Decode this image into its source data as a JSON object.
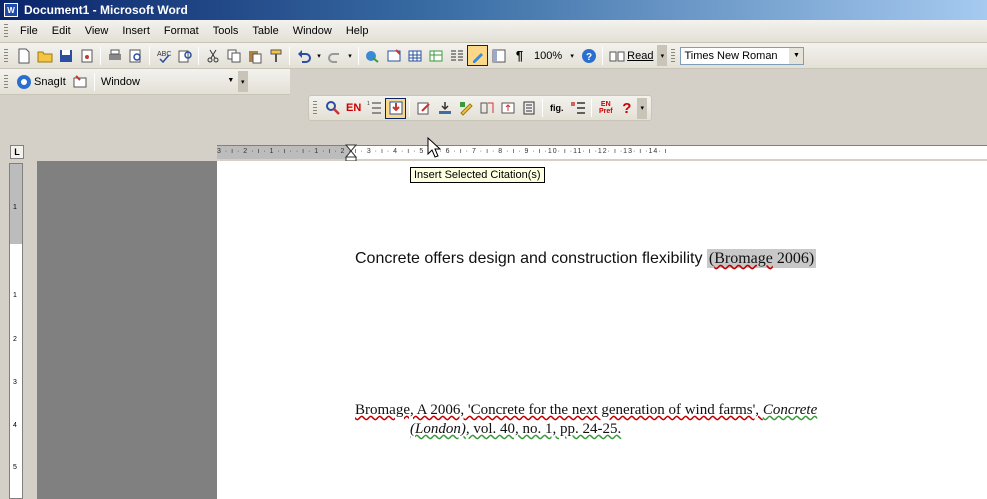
{
  "window": {
    "title": "Document1 - Microsoft Word",
    "app_icon": "W"
  },
  "menu": [
    {
      "label": "File"
    },
    {
      "label": "Edit"
    },
    {
      "label": "View"
    },
    {
      "label": "Insert"
    },
    {
      "label": "Format"
    },
    {
      "label": "Tools"
    },
    {
      "label": "Table"
    },
    {
      "label": "Window"
    },
    {
      "label": "Help"
    }
  ],
  "standard_toolbar": {
    "zoom": "100%",
    "read_label": "Read",
    "font": "Times New Roman"
  },
  "snagit_toolbar": {
    "snagit_label": "SnagIt",
    "capture_mode": "Window"
  },
  "endnote_toolbar": {
    "en_label": "EN",
    "fig_label": "fig.",
    "pref_label": "EN Pref",
    "help_label": "?"
  },
  "tooltip": "Insert Selected Citation(s)",
  "ruler": {
    "corner": "L",
    "ticks": "3 · ı · 2 · ı · 1 · ı ·   · ı · 1 · ı · 2 · ı · 3 · ı · 4 · ı · 5 · ı · 6 · ı · 7 · ı · 8 · ı · 9 · ı ·10· ı ·11· ı ·12· ı ·13· ı ·14· ı",
    "v_numbers": [
      "1",
      "1",
      "2",
      "3",
      "4",
      "5"
    ]
  },
  "document": {
    "sentence": "Concrete offers design and construction flexibility ",
    "citation_open": "(",
    "citation_author": "Bromage",
    "citation_rest": " 2006)",
    "reference_author": "Bromage, A 2006, 'Concrete for the next generation of wind farms', ",
    "reference_journal_1": "Concrete",
    "reference_journal_2": "(London)",
    "reference_tail": ", vol. 40, no. 1, pp. 24-25."
  }
}
